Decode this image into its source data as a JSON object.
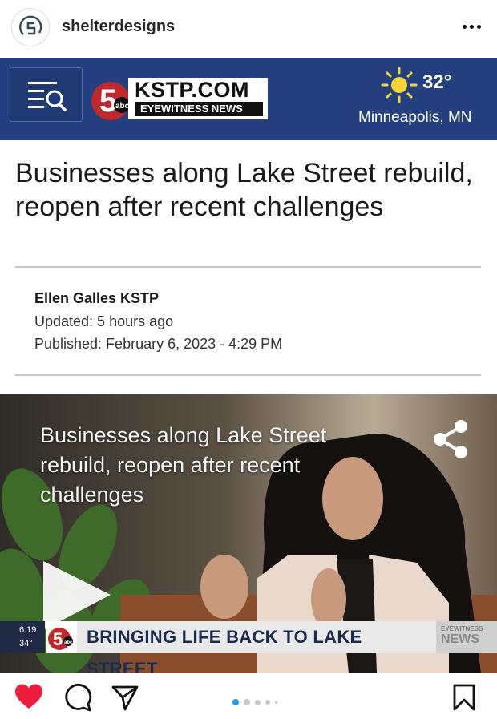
{
  "post_header": {
    "username": "shelterdesigns",
    "avatar_icon": "shelterdesigns-logo-icon",
    "more_icon": "more-options-icon"
  },
  "site": {
    "menu_icon": "menu-search-icon",
    "logo_numeral": "5",
    "logo_network": "abc",
    "logo_site": "KSTP.COM",
    "logo_tagline": "EYEWITNESS NEWS",
    "weather_icon": "sun-icon",
    "temperature": "32°",
    "location": "Minneapolis, MN",
    "colors": {
      "brand_blue": "#25407e",
      "logo_red": "#c0282d"
    }
  },
  "article": {
    "headline": "Businesses along Lake Street rebuild, reopen after recent challenges",
    "author": "Ellen Galles KSTP",
    "updated": "Updated: 5 hours ago",
    "published": "Published: February 6, 2023 - 4:29 PM"
  },
  "video": {
    "title": "Businesses along Lake Street rebuild, reopen after recent challenges",
    "share_icon": "share-icon",
    "play_icon": "play-icon",
    "lower_third": {
      "time": "6:19",
      "temp": "34°",
      "headline": "BRINGING LIFE BACK TO LAKE STREET",
      "brand_small": "EYEWITNESS",
      "brand_large": "NEWS"
    }
  },
  "action_bar": {
    "like_icon": "heart-icon",
    "liked": true,
    "comment_icon": "comment-icon",
    "share_icon": "send-icon",
    "save_icon": "bookmark-icon",
    "carousel": {
      "total_visible_dots": 5,
      "active_index": 0,
      "active_color": "#1d9bf0"
    }
  }
}
